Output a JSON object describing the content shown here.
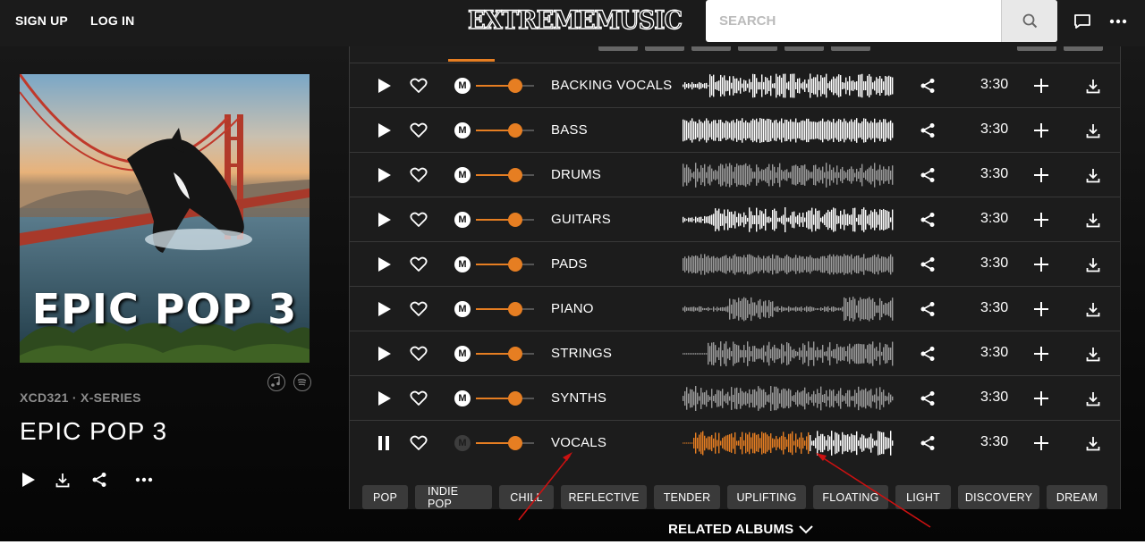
{
  "header": {
    "signup_label": "SIGN UP",
    "login_label": "LOG IN",
    "logo_text": "EXTREMEMUSIC",
    "search_placeholder": "SEARCH"
  },
  "album": {
    "cover_title": "EPIC POP 3",
    "code": "XCD321 · X-SERIES",
    "title": "EPIC POP 3"
  },
  "tracks": [
    {
      "name": "BACKING VOCALS",
      "duration": "3:30",
      "playing": false,
      "volume": 0.67
    },
    {
      "name": "BASS",
      "duration": "3:30",
      "playing": false,
      "volume": 0.67
    },
    {
      "name": "DRUMS",
      "duration": "3:30",
      "playing": false,
      "volume": 0.67
    },
    {
      "name": "GUITARS",
      "duration": "3:30",
      "playing": false,
      "volume": 0.67
    },
    {
      "name": "PADS",
      "duration": "3:30",
      "playing": false,
      "volume": 0.67
    },
    {
      "name": "PIANO",
      "duration": "3:30",
      "playing": false,
      "volume": 0.67
    },
    {
      "name": "STRINGS",
      "duration": "3:30",
      "playing": false,
      "volume": 0.67
    },
    {
      "name": "SYNTHS",
      "duration": "3:30",
      "playing": false,
      "volume": 0.67
    },
    {
      "name": "VOCALS",
      "duration": "3:30",
      "playing": true,
      "volume": 0.67,
      "progress": 0.6
    }
  ],
  "tags": [
    "POP",
    "INDIE POP",
    "CHILL",
    "REFLECTIVE",
    "TENDER",
    "UPLIFTING",
    "FLOATING",
    "LIGHT",
    "DISCOVERY",
    "DREAM"
  ],
  "related_label": "RELATED ALBUMS",
  "colors": {
    "accent": "#e67e22",
    "background": "#141414",
    "row_background": "#1c1c1c",
    "annotation": "#cc1111"
  }
}
